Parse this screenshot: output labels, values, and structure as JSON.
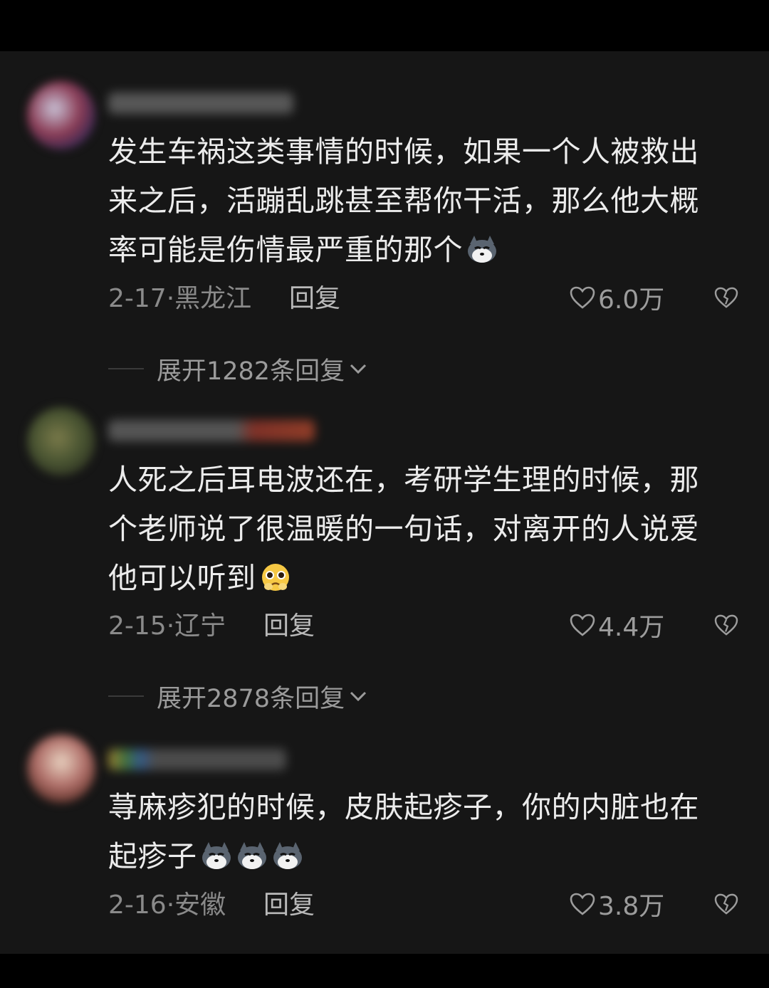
{
  "comments": [
    {
      "text": "发生车祸这类事情的时候，如果一个人被救出来之后，活蹦乱跳甚至帮你干活，那么他大概率可能是伤情最严重的那个",
      "emoji": "husky-emoji",
      "date_location": "2-17·黑龙江",
      "reply_label": "回复",
      "likes": "6.0万",
      "expand_label": "展开1282条回复"
    },
    {
      "text": "人死之后耳电波还在，考研学生理的时候，那个老师说了很温暖的一句话，对离开的人说爱他可以听到",
      "emoji": "pleading-face-emoji",
      "date_location": "2-15·辽宁",
      "reply_label": "回复",
      "likes": "4.4万",
      "expand_label": "展开2878条回复"
    },
    {
      "text": "荨麻疹犯的时候，皮肤起疹子，你的内脏也在起疹子",
      "emoji": "husky-emoji",
      "date_location": "2-16·安徽",
      "reply_label": "回复",
      "likes": "3.8万"
    }
  ]
}
